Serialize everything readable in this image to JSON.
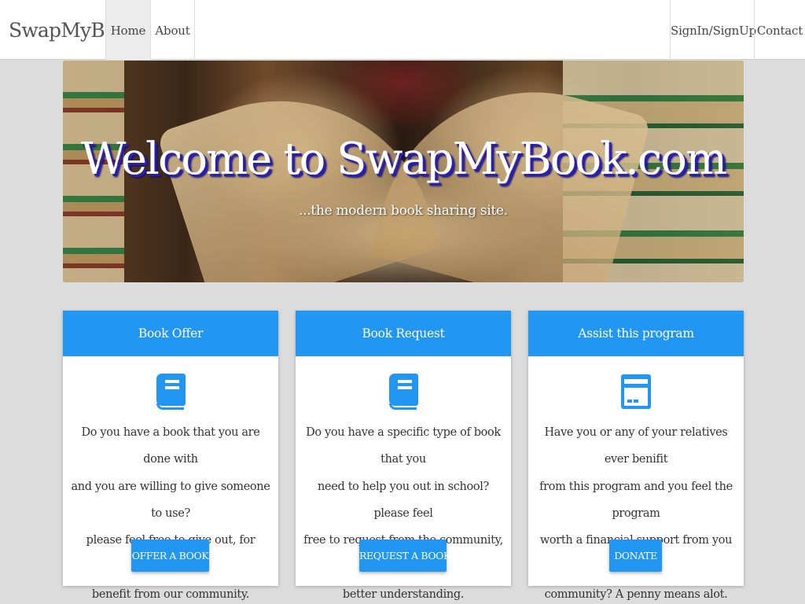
{
  "navbar": {
    "brand": "SwapMyBook",
    "left_items": [
      {
        "label": "Home",
        "active": true
      },
      {
        "label": "About",
        "active": false
      }
    ],
    "right_items": [
      {
        "label": "SignIn/SignUp"
      },
      {
        "label": "Contact"
      }
    ]
  },
  "hero": {
    "title": "Welcome to SwapMyBook.com",
    "subtitle": "...the modern book sharing site."
  },
  "cards": [
    {
      "header": "Book Offer",
      "icon": "book-icon",
      "lines": [
        "Do you have a book that you are done with",
        "and you are willing to give someone to use?",
        "please feel free to give out, for someone to",
        "benefit from our community."
      ],
      "button": "OFFER A BOOK"
    },
    {
      "header": "Book Request",
      "icon": "book-icon",
      "lines": [
        "Do you have a specific type of book that you",
        "need to help you out in school? please feel",
        "free to request from the community, for",
        "better understanding."
      ],
      "button": "REQUEST A BOOK"
    },
    {
      "header": "Assist this program",
      "icon": "payment-card-icon",
      "lines": [
        "Have you or any of your relatives ever benifit",
        "from this program and you feel the program",
        "worth a financial support from you or the",
        "community? A penny means alot."
      ],
      "button": "DONATE"
    }
  ],
  "colors": {
    "accent": "#2196f3",
    "background": "#dcdcdc",
    "navbar": "#ffffff",
    "title_shadow": "#2a1fb0"
  }
}
